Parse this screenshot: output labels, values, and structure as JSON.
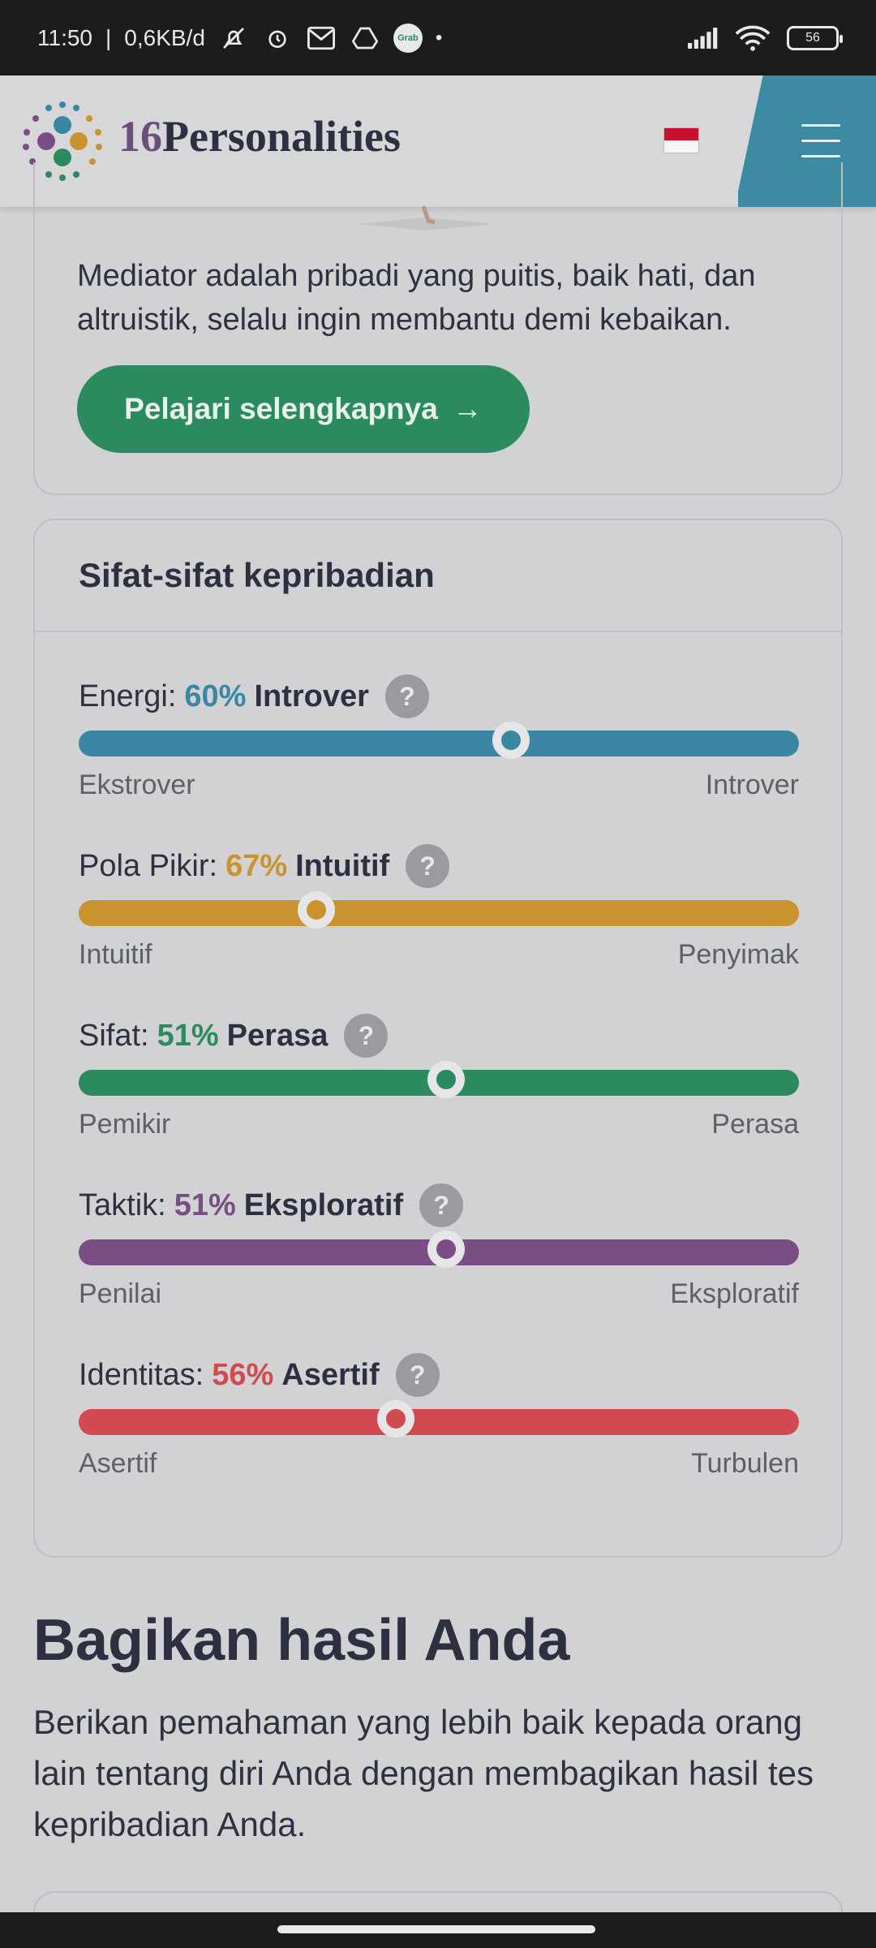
{
  "status_bar": {
    "time": "11:50",
    "net_speed": "0,6KB/d",
    "icons": [
      "bell-off-icon",
      "alarm-icon",
      "gmail-icon",
      "drive-icon",
      "grab-icon"
    ],
    "grab_label": "Grab",
    "battery": "56"
  },
  "header": {
    "brand_number": "16",
    "brand_name": "Personalities",
    "flag": "indonesia-flag",
    "menu_icon": "hamburger-menu-icon"
  },
  "intro": {
    "text": "Mediator adalah pribadi yang puitis, baik hati, dan altruistik, selalu ingin membantu demi kebaikan.",
    "button_label": "Pelajari selengkapnya",
    "button_arrow": "→"
  },
  "traits_card": {
    "title": "Sifat-sifat kepribadian",
    "help_glyph": "?",
    "traits": [
      {
        "label": "Energi:",
        "percent": "60%",
        "value": "Introver",
        "left": "Ekstrover",
        "right": "Introver",
        "color": "#3a87a3",
        "position": 0.6
      },
      {
        "label": "Pola Pikir:",
        "percent": "67%",
        "value": "Intuitif",
        "left": "Intuitif",
        "right": "Penyimak",
        "color": "#c9932d",
        "position": 0.33
      },
      {
        "label": "Sifat:",
        "percent": "51%",
        "value": "Perasa",
        "left": "Pemikir",
        "right": "Perasa",
        "color": "#2b8a5e",
        "position": 0.51
      },
      {
        "label": "Taktik:",
        "percent": "51%",
        "value": "Eksploratif",
        "left": "Penilai",
        "right": "Eksploratif",
        "color": "#7a4e85",
        "position": 0.51
      },
      {
        "label": "Identitas:",
        "percent": "56%",
        "value": "Asertif",
        "left": "Asertif",
        "right": "Turbulen",
        "color": "#d04a4f",
        "position": 0.44
      }
    ]
  },
  "share": {
    "title": "Bagikan hasil Anda",
    "text": "Berikan pemahaman yang lebih baik kepada orang lain tentang diri Anda dengan membagikan hasil tes kepribadian Anda."
  }
}
